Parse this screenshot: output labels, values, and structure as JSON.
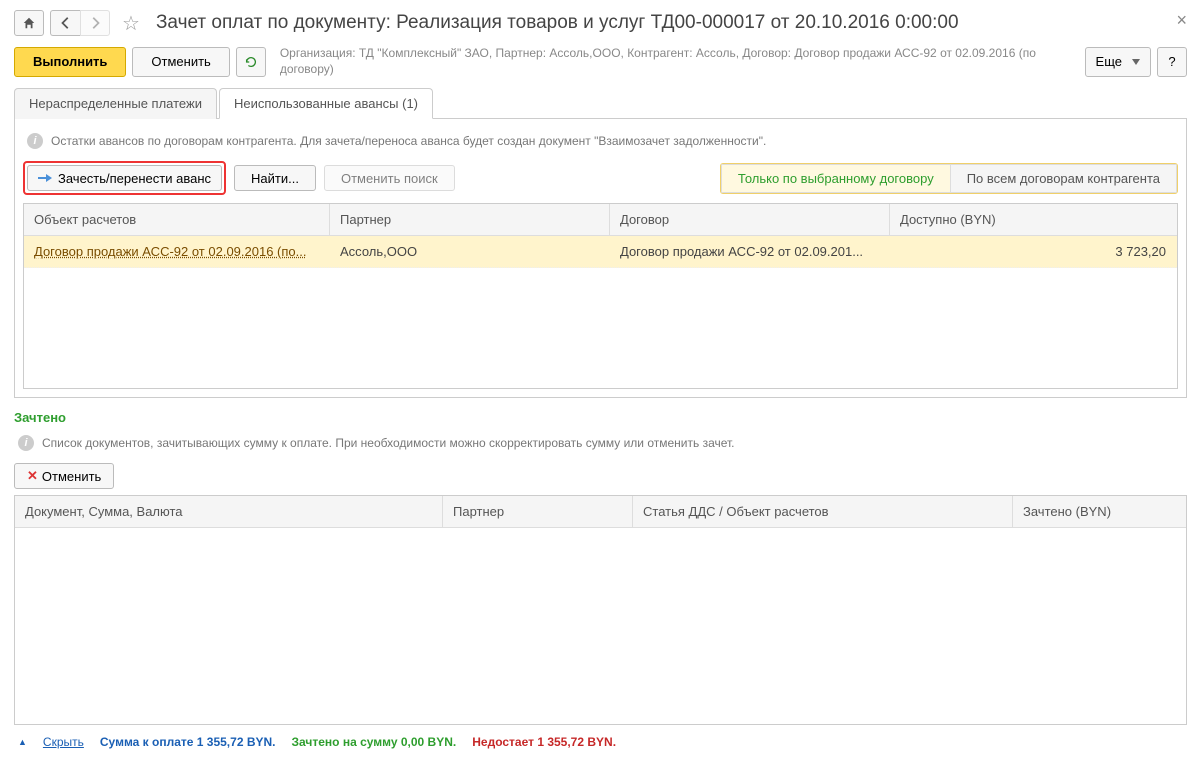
{
  "header": {
    "title": "Зачет оплат по документу: Реализация товаров и услуг ТД00-000017 от 20.10.2016 0:00:00"
  },
  "command": {
    "execute": "Выполнить",
    "cancel": "Отменить",
    "info": "Организация: ТД \"Комплексный\" ЗАО, Партнер: Ассоль,ООО, Контрагент: Ассоль, Договор: Договор продажи АСС-92 от 02.09.2016 (по договору)",
    "more": "Еще",
    "help": "?"
  },
  "tabs": {
    "tab1": "Нераспределенные платежи",
    "tab2": "Неиспользованные авансы (1)"
  },
  "advances": {
    "info": "Остатки авансов по договорам контрагента. Для зачета/переноса аванса будет создан документ \"Взаимозачет задолженности\".",
    "transfer_btn": "Зачесть/перенести аванс",
    "find_btn": "Найти...",
    "cancel_search_btn": "Отменить поиск",
    "filter_selected": "Только по выбранному договору",
    "filter_all": "По всем договорам контрагента",
    "col_object": "Объект расчетов",
    "col_partner": "Партнер",
    "col_contract": "Договор",
    "col_amount": "Доступно (BYN)",
    "rows": [
      {
        "object": "Договор продажи АСС-92 от 02.09.2016 (по...",
        "partner": "Ассоль,ООО",
        "contract": "Договор продажи АСС-92 от 02.09.201...",
        "amount": "3 723,20"
      }
    ]
  },
  "offset": {
    "label": "Зачтено",
    "info": "Список документов, зачитывающих сумму к оплате. При необходимости можно скорректировать сумму или отменить зачет.",
    "cancel_btn": "Отменить",
    "col_doc": "Документ, Сумма, Валюта",
    "col_partner": "Партнер",
    "col_dds": "Статья ДДС / Объект расчетов",
    "col_amount": "Зачтено (BYN)"
  },
  "footer": {
    "hide": "Скрыть",
    "to_pay": "Сумма к оплате 1 355,72 BYN.",
    "offset": "Зачтено на сумму 0,00 BYN.",
    "missing": "Недостает 1 355,72 BYN."
  }
}
